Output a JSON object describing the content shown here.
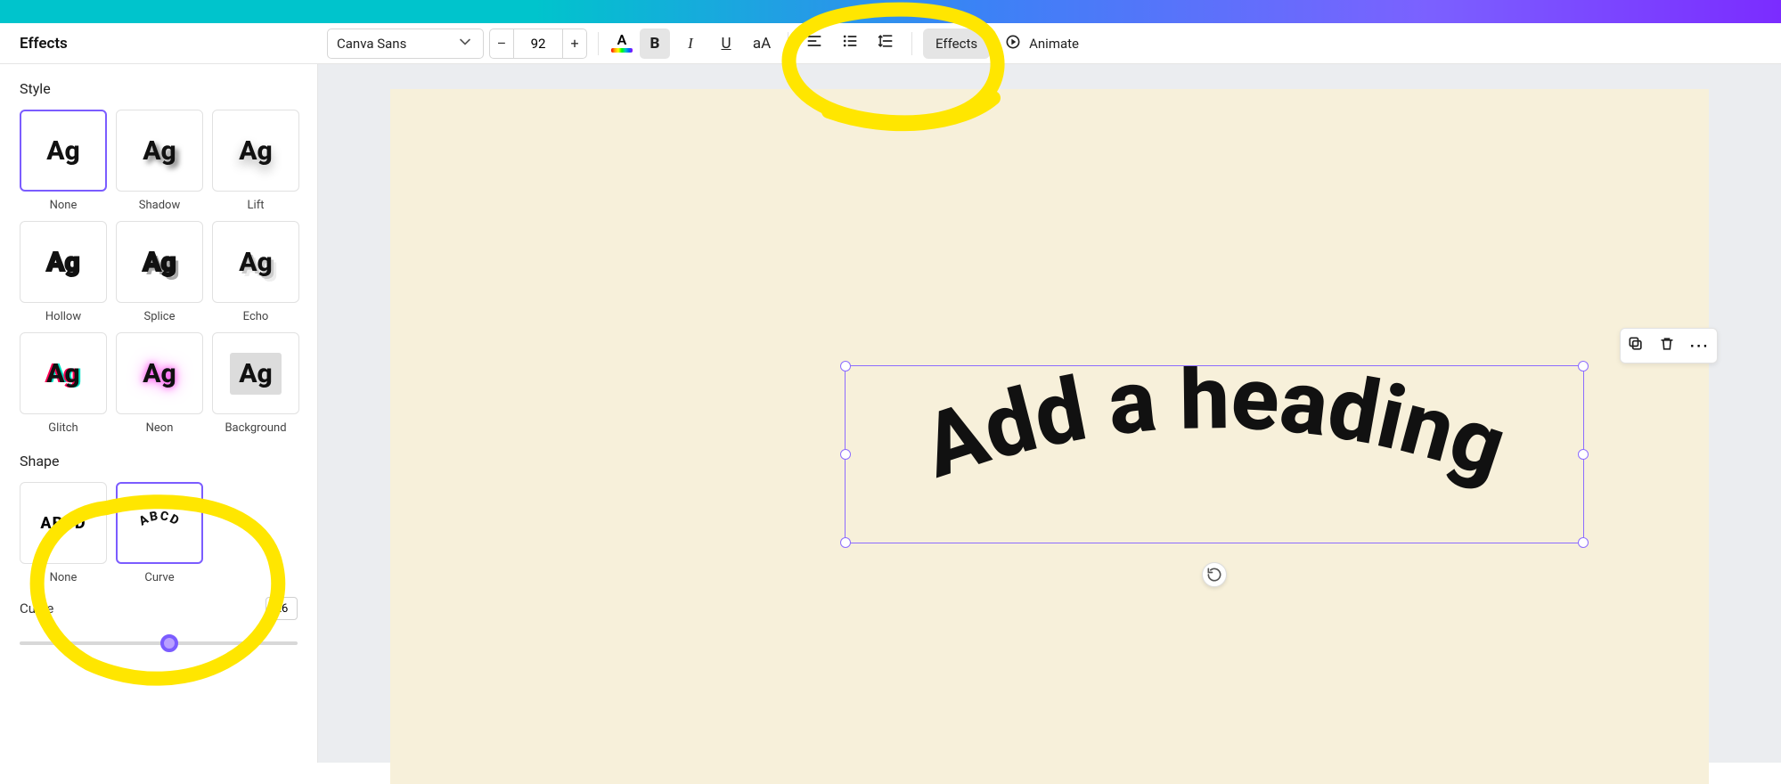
{
  "sidebar": {
    "heading": "Effects",
    "style_label": "Style",
    "styles": [
      {
        "key": "none",
        "label": "None"
      },
      {
        "key": "shadow",
        "label": "Shadow"
      },
      {
        "key": "lift",
        "label": "Lift"
      },
      {
        "key": "hollow",
        "label": "Hollow"
      },
      {
        "key": "splice",
        "label": "Splice"
      },
      {
        "key": "echo",
        "label": "Echo"
      },
      {
        "key": "glitch",
        "label": "Glitch"
      },
      {
        "key": "neon",
        "label": "Neon"
      },
      {
        "key": "background",
        "label": "Background"
      }
    ],
    "shape_label": "Shape",
    "shapes": [
      {
        "key": "none",
        "label": "None",
        "sample": "ABCD"
      },
      {
        "key": "curve",
        "label": "Curve",
        "sample": "ABCD"
      }
    ],
    "curve_slider": {
      "label": "Curve",
      "value": "26"
    }
  },
  "toolbar": {
    "font_name": "Canva Sans",
    "font_size": "92",
    "minus": "–",
    "plus": "+",
    "color_letter": "A",
    "bold": "B",
    "italic": "I",
    "underline": "U",
    "case": "aA",
    "effects": "Effects",
    "animate": "Animate"
  },
  "canvas": {
    "text": "Add a heading",
    "floating_tools": {
      "duplicate": "⧉",
      "trash": "🗑",
      "more": "⋯"
    },
    "rotate": "↻"
  },
  "colors": {
    "selection": "#8c6cff",
    "canvas": "#f7f0da",
    "highlight": "#ffe600"
  }
}
